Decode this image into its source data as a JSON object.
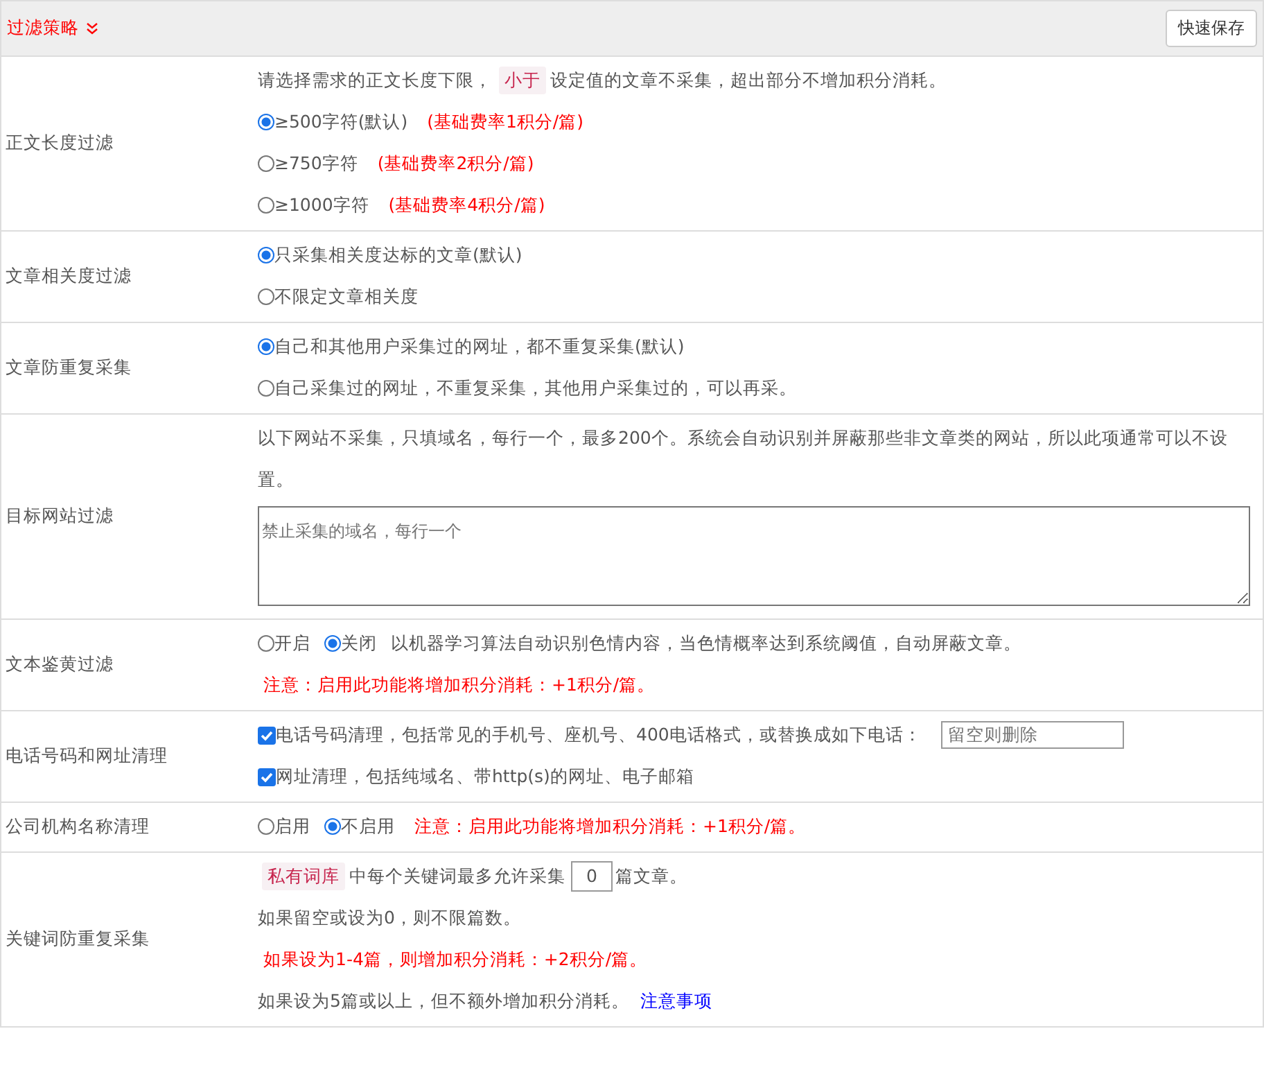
{
  "header": {
    "title": "过滤策略",
    "save_button": "快速保存"
  },
  "rows": [
    {
      "label": "正文长度过滤",
      "lines": [
        [
          {
            "kind": "text",
            "text": "请选择需求的正文长度下限，"
          },
          {
            "kind": "tag",
            "text": "小于"
          },
          {
            "kind": "text",
            "text": "设定值的文章不采集，超出部分不增加积分消耗。"
          }
        ],
        [
          {
            "kind": "radio",
            "text": "≥500字符(默认)",
            "selected": true
          },
          {
            "kind": "warn",
            "text": "(基础费率1积分/篇)"
          }
        ],
        [
          {
            "kind": "radio",
            "text": "≥750字符",
            "selected": false
          },
          {
            "kind": "warn",
            "text": "(基础费率2积分/篇)"
          }
        ],
        [
          {
            "kind": "radio",
            "text": "≥1000字符",
            "selected": false
          },
          {
            "kind": "warn",
            "text": "(基础费率4积分/篇)"
          }
        ]
      ]
    },
    {
      "label": "文章相关度过滤",
      "lines": [
        [
          {
            "kind": "radio",
            "text": "只采集相关度达标的文章(默认)",
            "selected": true
          }
        ],
        [
          {
            "kind": "radio",
            "text": "不限定文章相关度",
            "selected": false
          }
        ]
      ]
    },
    {
      "label": "文章防重复采集",
      "lines": [
        [
          {
            "kind": "radio",
            "text": "自己和其他用户采集过的网址，都不重复采集(默认)",
            "selected": true
          }
        ],
        [
          {
            "kind": "radio",
            "text": "自己采集过的网址，不重复采集，其他用户采集过的，可以再采。",
            "selected": false
          }
        ]
      ]
    },
    {
      "label": "目标网站过滤",
      "lines": [
        [
          {
            "kind": "text",
            "text": "以下网站不采集，只填域名，每行一个，最多200个。系统会自动识别并屏蔽那些非文章类的网站，所以此项通常可以不设置。"
          }
        ],
        [
          {
            "kind": "textarea",
            "placeholder": "禁止采集的域名，每行一个"
          }
        ]
      ]
    },
    {
      "label": "文本鉴黄过滤",
      "lines": [
        [
          {
            "kind": "radio",
            "text": "开启",
            "selected": false
          },
          {
            "kind": "radio",
            "text": "关闭",
            "selected": true
          },
          {
            "kind": "text",
            "text": "以机器学习算法自动识别色情内容，当色情概率达到系统阈值，自动屏蔽文章。"
          }
        ],
        [
          {
            "kind": "warn",
            "text": "注意：启用此功能将增加积分消耗：+1积分/篇。"
          }
        ]
      ]
    },
    {
      "label": "电话号码和网址清理",
      "lines": [
        [
          {
            "kind": "checkbox",
            "text": "电话号码清理，包括常见的手机号、座机号、400电话格式，或替换成如下电话：",
            "checked": true
          },
          {
            "kind": "field",
            "placeholder": "留空则删除"
          }
        ],
        [
          {
            "kind": "checkbox",
            "text": "网址清理，包括纯域名、带http(s)的网址、电子邮箱",
            "checked": true
          }
        ]
      ]
    },
    {
      "label": "公司机构名称清理",
      "lines": [
        [
          {
            "kind": "radio",
            "text": "启用",
            "selected": false
          },
          {
            "kind": "radio",
            "text": "不启用",
            "selected": true
          },
          {
            "kind": "warn",
            "text": "注意：启用此功能将增加积分消耗：+1积分/篇。"
          }
        ]
      ]
    },
    {
      "label": "关键词防重复采集",
      "lines": [
        [
          {
            "kind": "tag",
            "text": "私有词库"
          },
          {
            "kind": "text",
            "text": "中每个关键词最多允许采集"
          },
          {
            "kind": "number",
            "value": "0"
          },
          {
            "kind": "text",
            "text": "篇文章。"
          }
        ],
        [
          {
            "kind": "text",
            "text": "如果留空或设为0，则不限篇数。"
          }
        ],
        [
          {
            "kind": "warn",
            "text": "如果设为1-4篇，则增加积分消耗：+2积分/篇。"
          }
        ],
        [
          {
            "kind": "text",
            "text": "如果设为5篇或以上，但不额外增加积分消耗。"
          },
          {
            "kind": "link",
            "text": "注意事项"
          }
        ]
      ]
    }
  ]
}
